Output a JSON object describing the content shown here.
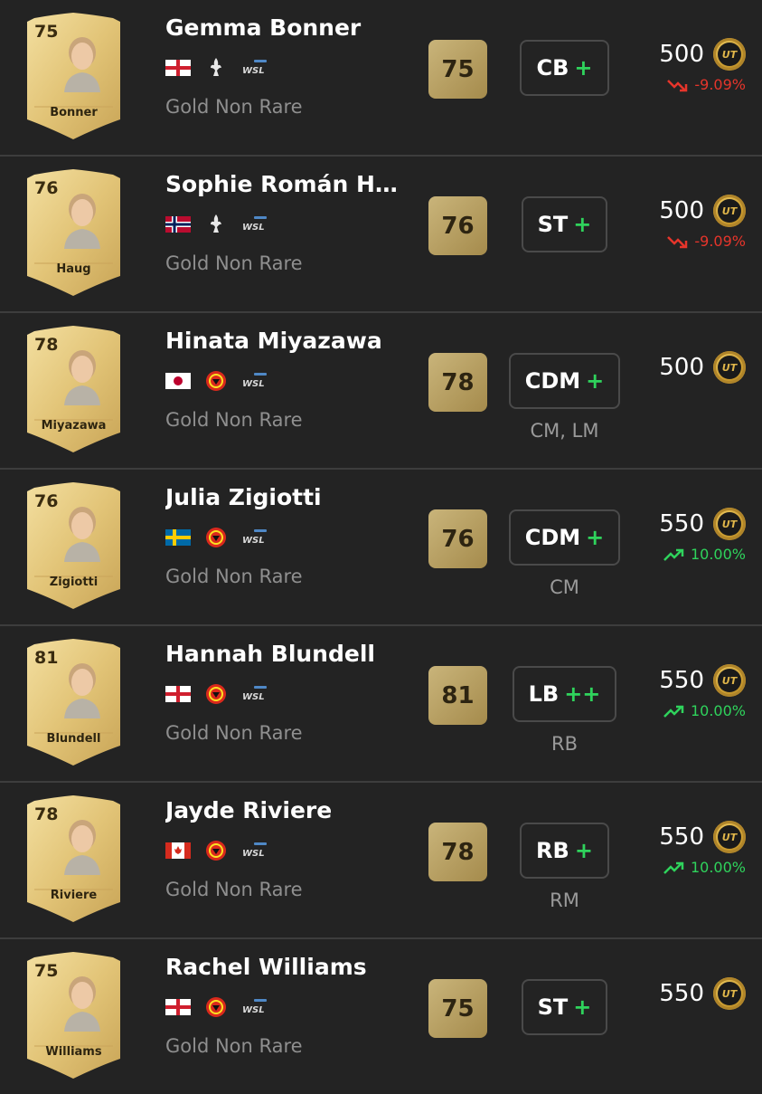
{
  "players": [
    {
      "name": "Gemma Bonner",
      "card_name": "Bonner",
      "rating": "75",
      "flag": "england",
      "club": "liverpool",
      "league": "wsl",
      "rarity": "Gold Non Rare",
      "position": "CB",
      "plus": "+",
      "alt_positions": "",
      "price": "500",
      "change": "-9.09%",
      "trend": "down"
    },
    {
      "name": "Sophie Román H…",
      "card_name": "Haug",
      "rating": "76",
      "flag": "norway",
      "club": "liverpool",
      "league": "wsl",
      "rarity": "Gold Non Rare",
      "position": "ST",
      "plus": "+",
      "alt_positions": "",
      "price": "500",
      "change": "-9.09%",
      "trend": "down"
    },
    {
      "name": "Hinata Miyazawa",
      "card_name": "Miyazawa",
      "rating": "78",
      "flag": "japan",
      "club": "man-utd",
      "league": "wsl",
      "rarity": "Gold Non Rare",
      "position": "CDM",
      "plus": "+",
      "alt_positions": "CM, LM",
      "price": "500",
      "change": "",
      "trend": "none"
    },
    {
      "name": "Julia Zigiotti",
      "card_name": "Zigiotti",
      "rating": "76",
      "flag": "sweden",
      "club": "man-utd",
      "league": "wsl",
      "rarity": "Gold Non Rare",
      "position": "CDM",
      "plus": "+",
      "alt_positions": "CM",
      "price": "550",
      "change": "10.00%",
      "trend": "up"
    },
    {
      "name": "Hannah Blundell",
      "card_name": "Blundell",
      "rating": "81",
      "flag": "england",
      "club": "man-utd",
      "league": "wsl",
      "rarity": "Gold Non Rare",
      "position": "LB",
      "plus": "++",
      "alt_positions": "RB",
      "price": "550",
      "change": "10.00%",
      "trend": "up"
    },
    {
      "name": "Jayde Riviere",
      "card_name": "Riviere",
      "rating": "78",
      "flag": "canada",
      "club": "man-utd",
      "league": "wsl",
      "rarity": "Gold Non Rare",
      "position": "RB",
      "plus": "+",
      "alt_positions": "RM",
      "price": "550",
      "change": "10.00%",
      "trend": "up"
    },
    {
      "name": "Rachel Williams",
      "card_name": "Williams",
      "rating": "75",
      "flag": "england",
      "club": "man-utd",
      "league": "wsl",
      "rarity": "Gold Non Rare",
      "position": "ST",
      "plus": "+",
      "alt_positions": "",
      "price": "550",
      "change": "",
      "trend": "none"
    }
  ],
  "coin_label": "UT",
  "league_label": "WSL",
  "colors": {
    "background": "#232323",
    "gold": "#c9b47a",
    "up": "#2fd35c",
    "down": "#e6352b",
    "muted": "#8f8f8f"
  }
}
